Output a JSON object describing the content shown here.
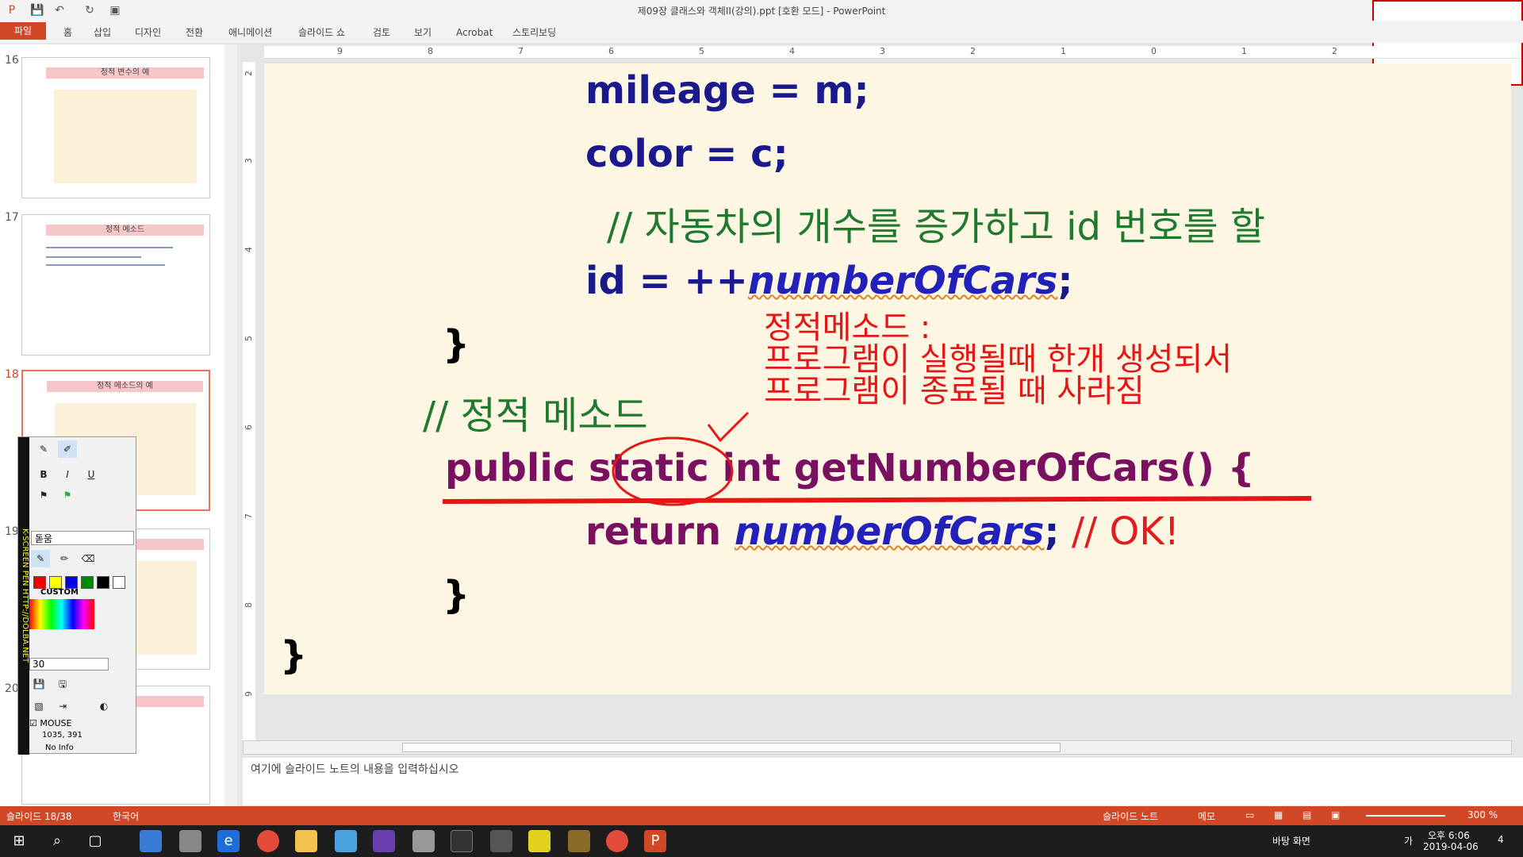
{
  "window": {
    "title": "제09장 클래스와 객체II(강의).ppt [호환 모드] - PowerPoint"
  },
  "ribbon": {
    "file": "파일",
    "tabs": [
      "홈",
      "삽입",
      "디자인",
      "전환",
      "애니메이션",
      "슬라이드 쇼",
      "검토",
      "보기",
      "Acrobat",
      "스토리보딩"
    ]
  },
  "thumbnails": [
    {
      "num": "16",
      "title": "정적 변수의 예"
    },
    {
      "num": "17",
      "title": "정적 메소드"
    },
    {
      "num": "18",
      "title": "정적 메소드의 예"
    },
    {
      "num": "19",
      "title": "의 예"
    },
    {
      "num": "20",
      "title": ""
    }
  ],
  "ruler": {
    "top": [
      "9",
      "8",
      "7",
      "6",
      "5",
      "4",
      "3",
      "2",
      "1",
      "0",
      "1",
      "2"
    ],
    "left": [
      "2",
      "3",
      "4",
      "5",
      "6",
      "7",
      "8",
      "9"
    ]
  },
  "slide": {
    "code_lines": [
      "mileage = m;",
      "color = c;",
      "// 자동차의 개수를 증가하고 id 번호를 할",
      "id = ++",
      "numberOfCars",
      ";",
      "}",
      "// 정적 메소드",
      "public",
      "static",
      "int getNumberOfCars() {",
      "return ",
      "numberOfCars",
      ";",
      " // OK!",
      "}",
      "}"
    ],
    "annotation": [
      "정적메소드 :",
      "프로그램이 실행될때 한개 생성되서",
      "프로그램이 종료될 때 사라짐"
    ]
  },
  "notes": {
    "placeholder": "여기에 슬라이드 노트의 내용을 입력하십시오"
  },
  "status": {
    "slide": "슬라이드 18/38",
    "lang": "한국어",
    "notes_btn": "슬라이드 노트",
    "memo": "메모",
    "zoom": "300 %"
  },
  "pen": {
    "strip": "K-SCREEN PEN HTTP://DOLBA.NET",
    "font": "돋움",
    "custom": "CUSTOM",
    "size": "30",
    "mouse": "MOUSE",
    "coords": "1035, 391",
    "info": "No Info",
    "bold": "B",
    "italic": "I",
    "underline": "U"
  },
  "taskbar": {
    "desktop": "바탕 화면",
    "ime": "가",
    "time": "오후 6:06",
    "date": "2019-04-06",
    "notif": "4"
  },
  "colors": {
    "accent": "#d24726",
    "annotation": "#e51616"
  }
}
